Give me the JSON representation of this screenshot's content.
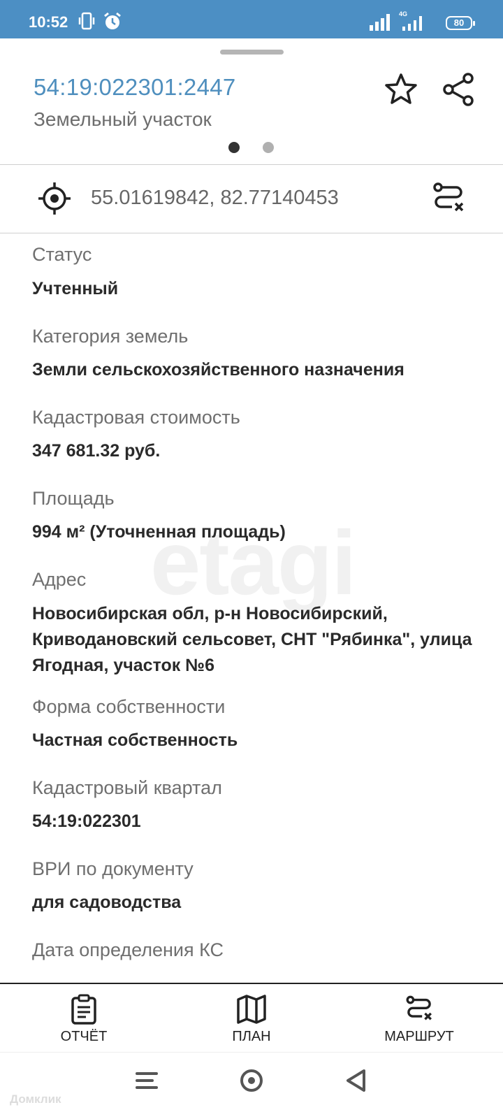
{
  "status_bar": {
    "time": "10:52",
    "network": "4G",
    "battery": "80",
    "icons": [
      "vibrate-icon",
      "alarm-icon",
      "signal-icon",
      "signal-4g-icon",
      "battery-icon"
    ]
  },
  "header": {
    "cadastral_number": "54:19:022301:2447",
    "object_type": "Земельный участок",
    "accent_color": "#4f8fbe",
    "page_indicator": {
      "count": 2,
      "active": 1
    }
  },
  "location": {
    "coordinates": "55.01619842, 82.77140453"
  },
  "fields": [
    {
      "label": "Статус",
      "value": "Учтенный"
    },
    {
      "label": "Категория земель",
      "value": "Земли сельскохозяйственного назначения"
    },
    {
      "label": "Кадастровая стоимость",
      "value": "347 681.32 руб."
    },
    {
      "label": "Площадь",
      "value": "994 м² (Уточненная площадь)"
    },
    {
      "label": "Адрес",
      "value": "Новосибирская обл, р-н Новосибирский, Криводановский сельсовет, СНТ \"Рябинка\", улица Ягодная, участок №6"
    },
    {
      "label": "Форма собственности",
      "value": "Частная собственность"
    },
    {
      "label": "Кадастровый квартал",
      "value": "54:19:022301"
    },
    {
      "label": "ВРИ по документу",
      "value": "для садоводства"
    },
    {
      "label": "Дата определения КС",
      "value": ""
    }
  ],
  "watermark": "etagi",
  "bottom_tabs": [
    {
      "label": "ОТЧЁТ",
      "icon": "clipboard-icon"
    },
    {
      "label": "ПЛАН",
      "icon": "map-icon"
    },
    {
      "label": "МАРШРУТ",
      "icon": "route-icon"
    }
  ],
  "corner_watermark": "Домклик"
}
